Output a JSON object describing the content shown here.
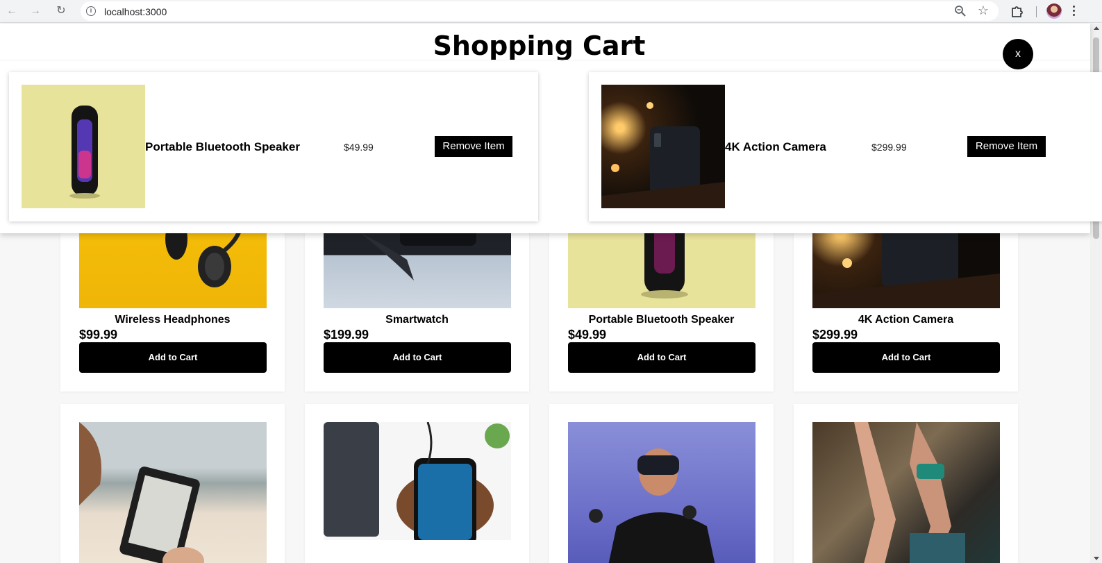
{
  "browser": {
    "url": "localhost:3000"
  },
  "cart": {
    "title": "Shopping Cart",
    "close_label": "x",
    "items": [
      {
        "name": "Portable Bluetooth Speaker",
        "price": "$49.99",
        "remove_label": "Remove Item",
        "icon": "speaker-image"
      },
      {
        "name": "4K Action Camera",
        "price": "$299.99",
        "remove_label": "Remove Item",
        "icon": "camera-image"
      }
    ]
  },
  "products": [
    {
      "name": "Wireless Headphones",
      "price": "$99.99",
      "button": "Add to Cart"
    },
    {
      "name": "Smartwatch",
      "price": "$199.99",
      "button": "Add to Cart"
    },
    {
      "name": "Portable Bluetooth Speaker",
      "price": "$49.99",
      "button": "Add to Cart"
    },
    {
      "name": "4K Action Camera",
      "price": "$299.99",
      "button": "Add to Cart"
    },
    {
      "name": "",
      "price": "",
      "button": ""
    },
    {
      "name": "",
      "price": "",
      "button": ""
    },
    {
      "name": "",
      "price": "",
      "button": ""
    },
    {
      "name": "",
      "price": "",
      "button": ""
    }
  ],
  "colors": {
    "button_bg": "#000000",
    "button_text": "#ffffff",
    "page_bg": "#f7f7f7"
  }
}
